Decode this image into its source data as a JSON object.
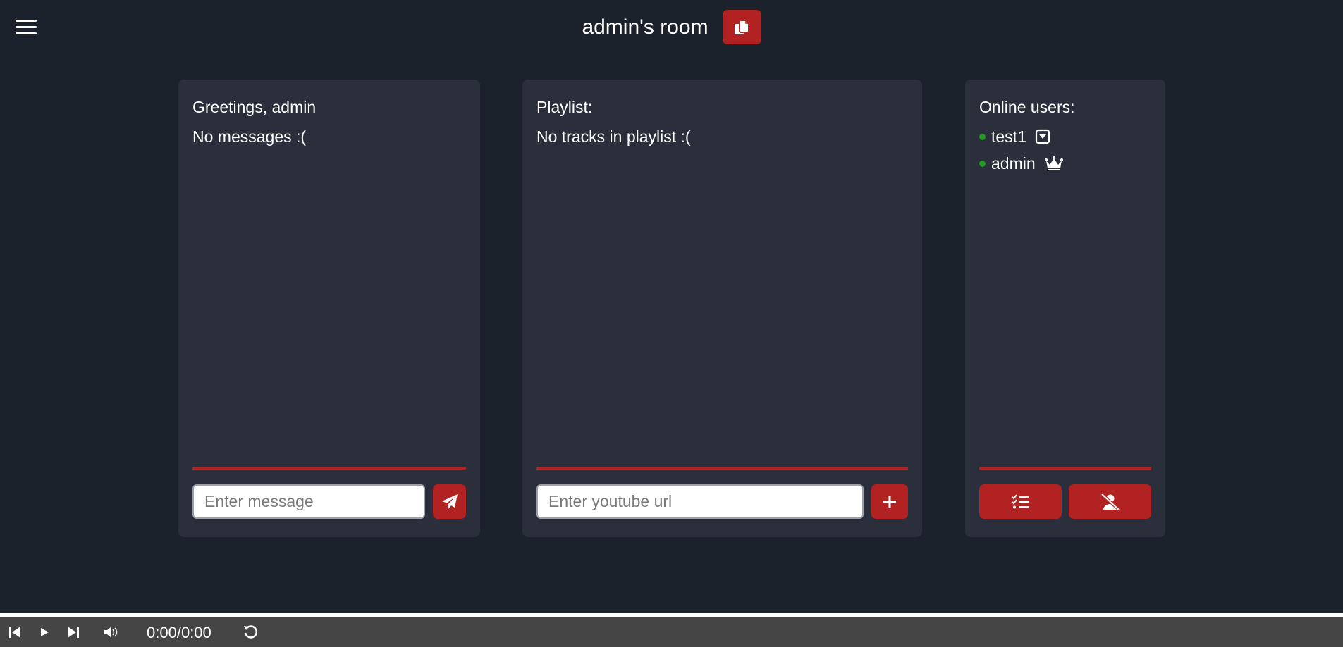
{
  "header": {
    "room_title": "admin's room",
    "menu_icon": "hamburger-menu-icon",
    "copy_icon": "copy-icon"
  },
  "chat": {
    "title": "Greetings, admin",
    "empty_text": "No messages :(",
    "input_placeholder": "Enter message",
    "input_value": "",
    "send_icon": "paper-plane-icon"
  },
  "playlist": {
    "title": "Playlist:",
    "empty_text": "No tracks in playlist :(",
    "input_placeholder": "Enter youtube url",
    "input_value": "",
    "add_icon": "plus-icon"
  },
  "users": {
    "title": "Online users:",
    "items": [
      {
        "name": "test1",
        "status": "online",
        "badge_icon": "dropdown-box-icon"
      },
      {
        "name": "admin",
        "status": "online",
        "badge_icon": "crown-icon"
      }
    ],
    "buttons": [
      "checklist-icon",
      "remove-user-icon"
    ]
  },
  "player": {
    "current_time": "0:00",
    "separator": "/",
    "duration": "0:00",
    "progress": 0,
    "icons": [
      "skip-previous-icon",
      "play-icon",
      "skip-next-icon",
      "volume-icon",
      "replay-icon"
    ]
  },
  "colors": {
    "background": "#1c222c",
    "panel": "#2b2f3b",
    "accent": "#b22222",
    "online": "#1f9b1f",
    "player_bar": "#454545"
  }
}
